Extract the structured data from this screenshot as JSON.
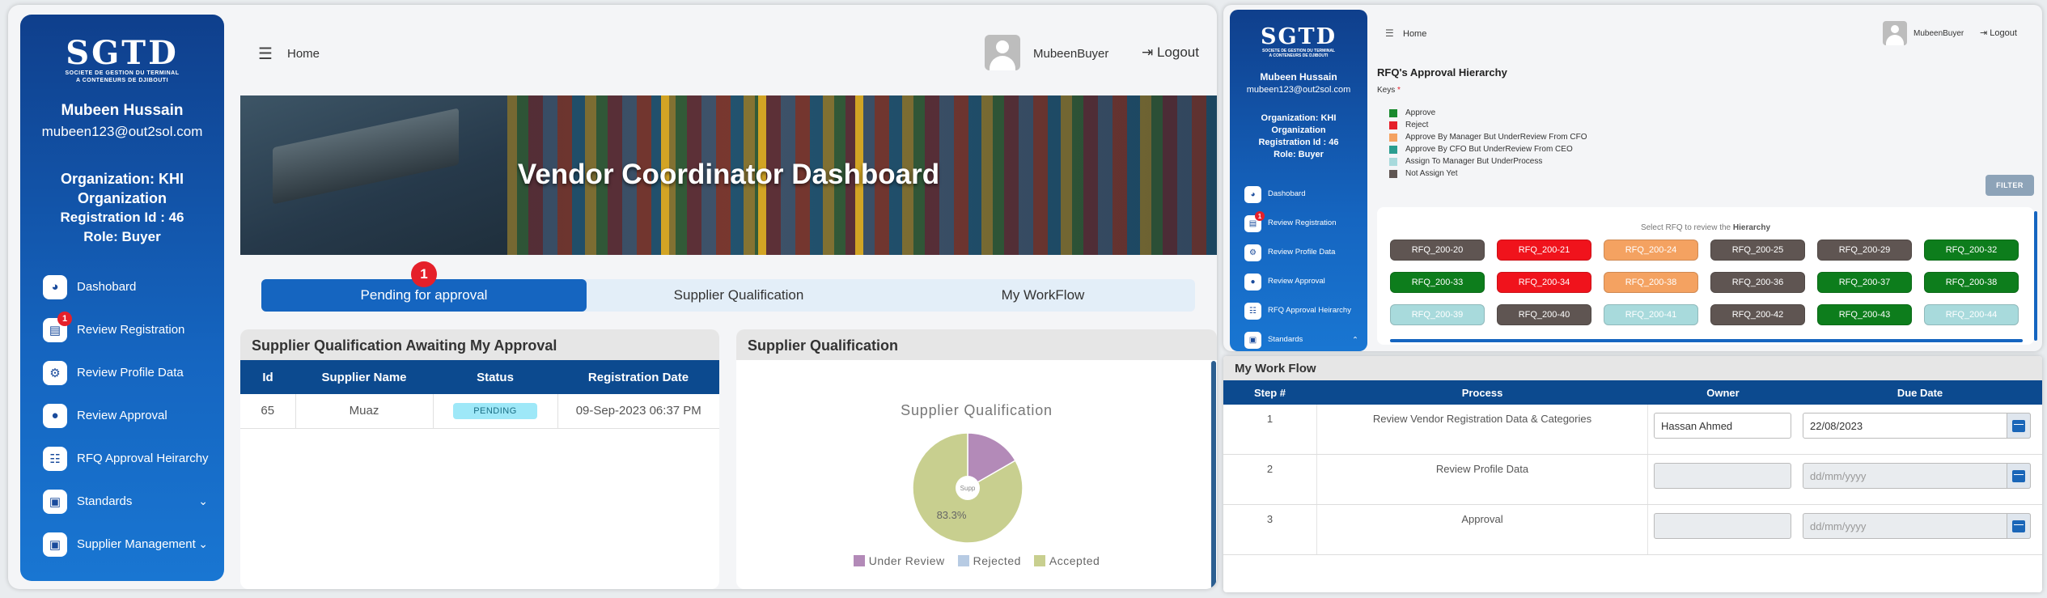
{
  "brand": {
    "logo_big": "SGTD",
    "logo_small_1": "SOCIETE DE GESTION DU TERMINAL",
    "logo_small_2": "A CONTENEURS DE DJIBOUTI"
  },
  "user": {
    "name": "Mubeen Hussain",
    "email": "mubeen123@out2sol.com",
    "organization_l": "Organization: KHI",
    "organization_l2": "Organization",
    "registration": "Registration Id : 46",
    "role": "Role: Buyer",
    "top_name": "MubeenBuyer"
  },
  "sidebar": {
    "items": [
      {
        "label": "Dashobard",
        "icon": "palette-icon"
      },
      {
        "label": "Review Registration",
        "icon": "id-card-icon",
        "badge": "1"
      },
      {
        "label": "Review Profile Data",
        "icon": "user-gear-icon"
      },
      {
        "label": "Review Approval",
        "icon": "chat-icon"
      },
      {
        "label": "RFQ Approval Heirarchy",
        "icon": "hierarchy-icon"
      },
      {
        "label": "Standards",
        "icon": "clipboard-icon",
        "chevron": "⌄"
      },
      {
        "label": "Supplier Management",
        "icon": "clipboard-user-icon",
        "chevron": "⌄"
      }
    ],
    "standards_chevron_r": "⌃"
  },
  "topbar": {
    "home": "Home",
    "logout": "Logout"
  },
  "banner": {
    "title": "Vendor Coordinator Dashboard"
  },
  "tabs": [
    {
      "label": "Pending for approval",
      "badge": "1"
    },
    {
      "label": "Supplier Qualification"
    },
    {
      "label": "My WorkFlow"
    }
  ],
  "awaiting": {
    "title": "Supplier Qualification Awaiting My Approval",
    "columns": [
      "Id",
      "Supplier Name",
      "Status",
      "Registration Date"
    ],
    "rows": [
      {
        "id": "65",
        "name": "Muaz",
        "status": "PENDING",
        "date": "09-Sep-2023 06:37 PM"
      }
    ]
  },
  "qual_card": {
    "title": "Supplier Qualification"
  },
  "chart_data": {
    "type": "pie",
    "title": "Supplier Qualification",
    "series": [
      {
        "name": "Under Review",
        "value": 16.7,
        "color": "#b38ab8"
      },
      {
        "name": "Rejected",
        "value": 0,
        "color": "#b7cbe3"
      },
      {
        "name": "Accepted",
        "value": 83.3,
        "color": "#c8cf8f"
      }
    ],
    "data_labels": [
      "83.3%"
    ],
    "center_label": "Supp",
    "legend_position": "bottom"
  },
  "rfq": {
    "title": "RFQ's Approval Hierarchy",
    "keys_label": "Keys",
    "keys_star": "*",
    "keys": [
      {
        "label": "Approve",
        "color": "#1a8a2e"
      },
      {
        "label": "Reject",
        "color": "#e5202a"
      },
      {
        "label": "Approve By Manager But UnderReview From CFO",
        "color": "#f4a261"
      },
      {
        "label": "Approve By CFO But UnderReview From CEO",
        "color": "#2a9d8f"
      },
      {
        "label": "Assign To Manager But UnderProcess",
        "color": "#a8dadc"
      },
      {
        "label": "Not Assign Yet",
        "color": "#5f5552"
      }
    ],
    "filter": "FILTER",
    "hint_prefix": "Select RFQ to review the",
    "hint_bold": "Hierarchy",
    "items": [
      {
        "label": "RFQ_200-20",
        "color": "#5f5552"
      },
      {
        "label": "RFQ_200-21",
        "color": "#f0131c"
      },
      {
        "label": "RFQ_200-24",
        "color": "#f4a261"
      },
      {
        "label": "RFQ_200-25",
        "color": "#5f5552"
      },
      {
        "label": "RFQ_200-29",
        "color": "#5f5552"
      },
      {
        "label": "RFQ_200-32",
        "color": "#0d7d1c"
      },
      {
        "label": "RFQ_200-33",
        "color": "#0d7d1c"
      },
      {
        "label": "RFQ_200-34",
        "color": "#f0131c"
      },
      {
        "label": "RFQ_200-38",
        "color": "#f4a261"
      },
      {
        "label": "RFQ_200-36",
        "color": "#5f5552"
      },
      {
        "label": "RFQ_200-37",
        "color": "#0d7d1c"
      },
      {
        "label": "RFQ_200-38",
        "color": "#0d7d1c"
      },
      {
        "label": "RFQ_200-39",
        "color": "#a8dadc"
      },
      {
        "label": "RFQ_200-40",
        "color": "#5f5552"
      },
      {
        "label": "RFQ_200-41",
        "color": "#a8dadc"
      },
      {
        "label": "RFQ_200-42",
        "color": "#5f5552"
      },
      {
        "label": "RFQ_200-43",
        "color": "#0d7d1c"
      },
      {
        "label": "RFQ_200-44",
        "color": "#a8dadc"
      }
    ]
  },
  "user_r": {
    "organization": "Organization: KHI",
    "organization2": "Organization",
    "registration": "Registration Id : 46",
    "role": "Role: Buyer"
  },
  "sidebar_r": {
    "items": [
      {
        "label": "Dashobard"
      },
      {
        "label": "Review Registration",
        "badge": "1"
      },
      {
        "label": "Review Profile Data"
      },
      {
        "label": "Review Approval"
      },
      {
        "label": "RFQ Approval Heirarchy"
      },
      {
        "label": "Standards"
      }
    ]
  },
  "workflow": {
    "title": "My Work Flow",
    "columns": [
      "Step #",
      "Process",
      "Owner",
      "Due Date"
    ],
    "rows": [
      {
        "step": "1",
        "process": "Review Vendor Registration Data & Categories",
        "owner": "Hassan Ahmed",
        "date": "22/08/2023",
        "date_placeholder": "dd/mm/yyyy"
      },
      {
        "step": "2",
        "process": "Review Profile Data",
        "owner": "",
        "date": "",
        "date_placeholder": "dd/mm/yyyy"
      },
      {
        "step": "3",
        "process": "Approval",
        "owner": "",
        "date": "",
        "date_placeholder": "dd/mm/yyyy"
      }
    ]
  }
}
